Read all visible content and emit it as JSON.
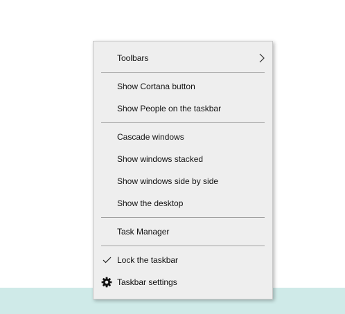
{
  "context_menu": {
    "items": [
      {
        "label": "Toolbars",
        "has_submenu": true
      },
      {
        "label": "Show Cortana button"
      },
      {
        "label": "Show People on the taskbar"
      },
      {
        "label": "Cascade windows"
      },
      {
        "label": "Show windows stacked"
      },
      {
        "label": "Show windows side by side"
      },
      {
        "label": "Show the desktop"
      },
      {
        "label": "Task Manager"
      },
      {
        "label": "Lock the taskbar",
        "checked": true,
        "icon": "check-icon"
      },
      {
        "label": "Taskbar settings",
        "icon": "gear-icon"
      }
    ]
  },
  "colors": {
    "menu_background": "#eeeeee",
    "separator": "#a0a0a0",
    "taskbar": "#cfeae8",
    "text": "#111111"
  }
}
